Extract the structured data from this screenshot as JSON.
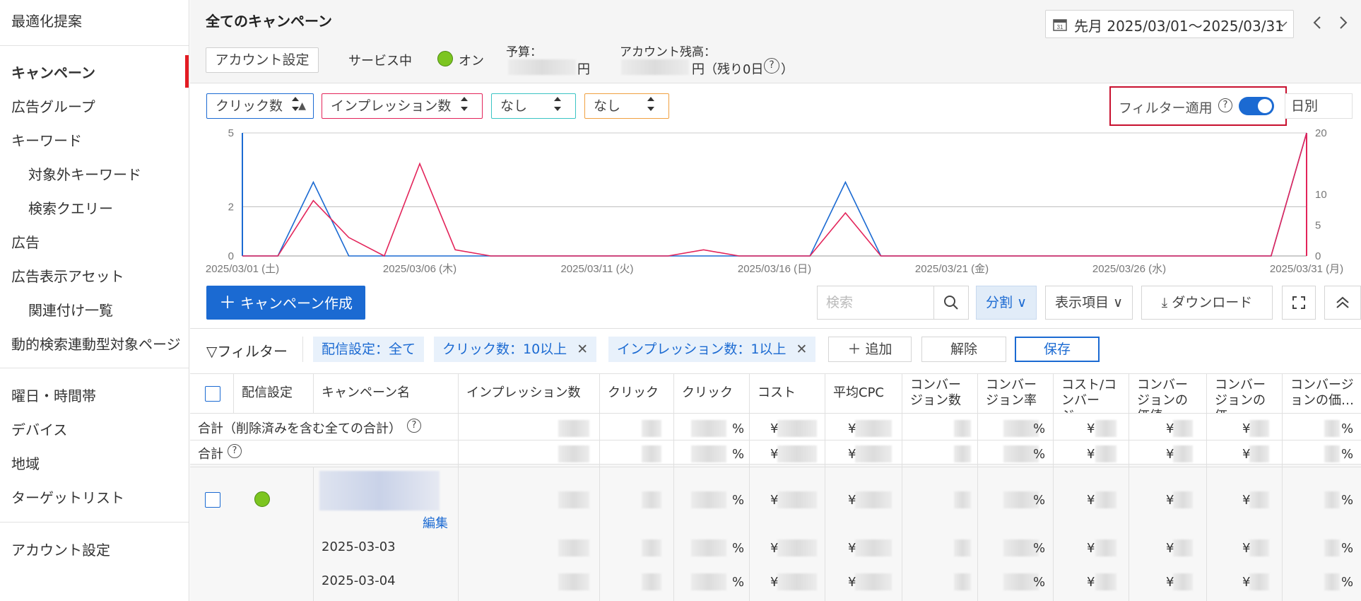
{
  "sidebar": {
    "top_item": "最適化提案",
    "items": [
      {
        "label": "キャンペーン"
      },
      {
        "label": "広告グループ"
      },
      {
        "label": "キーワード"
      },
      {
        "label": "対象外キーワード"
      },
      {
        "label": "検索クエリー"
      },
      {
        "label": "広告"
      },
      {
        "label": "広告表示アセット"
      },
      {
        "label": "関連付け一覧"
      },
      {
        "label": "動的検索連動型対象ページ"
      }
    ],
    "group2": [
      {
        "label": "曜日・時間帯"
      },
      {
        "label": "デバイス"
      },
      {
        "label": "地域"
      },
      {
        "label": "ターゲットリスト"
      }
    ],
    "account": "アカウント設定"
  },
  "header": {
    "title": "全てのキャンペーン",
    "account_settings_btn": "アカウント設定",
    "service_label": "サービス中",
    "status_on": "オン",
    "budget_label": "予算：",
    "budget_suffix": "円",
    "balance_label": "アカウント残高：",
    "balance_suffix": "円（残り0日",
    "balance_close": "）",
    "date_range": "先月 2025/03/01～2025/03/31",
    "help_glyph": "?"
  },
  "chart_controls": {
    "metric1": "クリック数",
    "metric2": "インプレッション数",
    "metric3": "なし",
    "metric4": "なし",
    "filter_apply": "フィルター適用",
    "granularity": "日別",
    "colors": {
      "metric1": "#1b6ad2",
      "metric2": "#e3245a",
      "metric3": "#3bc4c4",
      "metric4": "#f0a040"
    }
  },
  "chart_data": {
    "type": "line",
    "x": [
      "2025/03/01",
      "2025/03/02",
      "2025/03/03",
      "2025/03/04",
      "2025/03/05",
      "2025/03/06",
      "2025/03/07",
      "2025/03/08",
      "2025/03/09",
      "2025/03/10",
      "2025/03/11",
      "2025/03/12",
      "2025/03/13",
      "2025/03/14",
      "2025/03/15",
      "2025/03/16",
      "2025/03/17",
      "2025/03/18",
      "2025/03/19",
      "2025/03/20",
      "2025/03/21",
      "2025/03/22",
      "2025/03/23",
      "2025/03/24",
      "2025/03/25",
      "2025/03/26",
      "2025/03/27",
      "2025/03/28",
      "2025/03/29",
      "2025/03/30",
      "2025/03/31"
    ],
    "x_tick_labels": [
      "2025/03/01 (土)",
      "2025/03/06 (木)",
      "2025/03/11 (火)",
      "2025/03/16 (日)",
      "2025/03/21 (金)",
      "2025/03/26 (水)",
      "2025/03/31 (月)"
    ],
    "series": [
      {
        "name": "クリック数",
        "axis": "left",
        "values": [
          0,
          0,
          3,
          0,
          0,
          0,
          0,
          0,
          0,
          0,
          0,
          0,
          0,
          0,
          0,
          0,
          0,
          3,
          0,
          0,
          0,
          0,
          0,
          0,
          0,
          0,
          0,
          0,
          0,
          0,
          5
        ]
      },
      {
        "name": "インプレッション数",
        "axis": "right",
        "values": [
          0,
          0,
          9,
          3,
          0,
          15,
          1,
          0,
          0,
          0,
          0,
          0,
          0,
          1,
          0,
          0,
          0,
          7,
          0,
          0,
          0,
          0,
          0,
          0,
          0,
          0,
          0,
          0,
          0,
          0,
          20
        ]
      }
    ],
    "left_ticks": [
      "0",
      "2",
      "5"
    ],
    "right_ticks": [
      "0",
      "5",
      "10",
      "20"
    ],
    "ylim_left": [
      0,
      5
    ],
    "ylim_right": [
      0,
      20
    ],
    "grid": true
  },
  "toolbar": {
    "create_btn": "キャンペーン作成",
    "search_placeholder": "検索",
    "split": "分割",
    "columns": "表示項目",
    "download": "ダウンロード"
  },
  "filter_row": {
    "label": "フィルター",
    "chips": [
      "配信設定：全て",
      "クリック数：10以上",
      "インプレッション数：1以上"
    ],
    "add": "追加",
    "clear": "解除",
    "save": "保存"
  },
  "table": {
    "headers": [
      "配信設定",
      "キャンペーン名",
      "インプレッション数",
      "クリック数",
      "クリック率",
      "コスト",
      "平均CPC",
      "コンバージョン数",
      "コンバージョン率",
      "コスト/コンバージ…",
      "コンバージョンの価値",
      "コンバージョンの価…",
      "コンバージョンの価…"
    ],
    "total_all_label": "合計（削除済みを含む全ての合計）",
    "total_label": "合計",
    "edit_link": "編集",
    "rows": [
      "2025-03-03",
      "2025-03-04"
    ],
    "pct": "%",
    "yen": "¥"
  }
}
